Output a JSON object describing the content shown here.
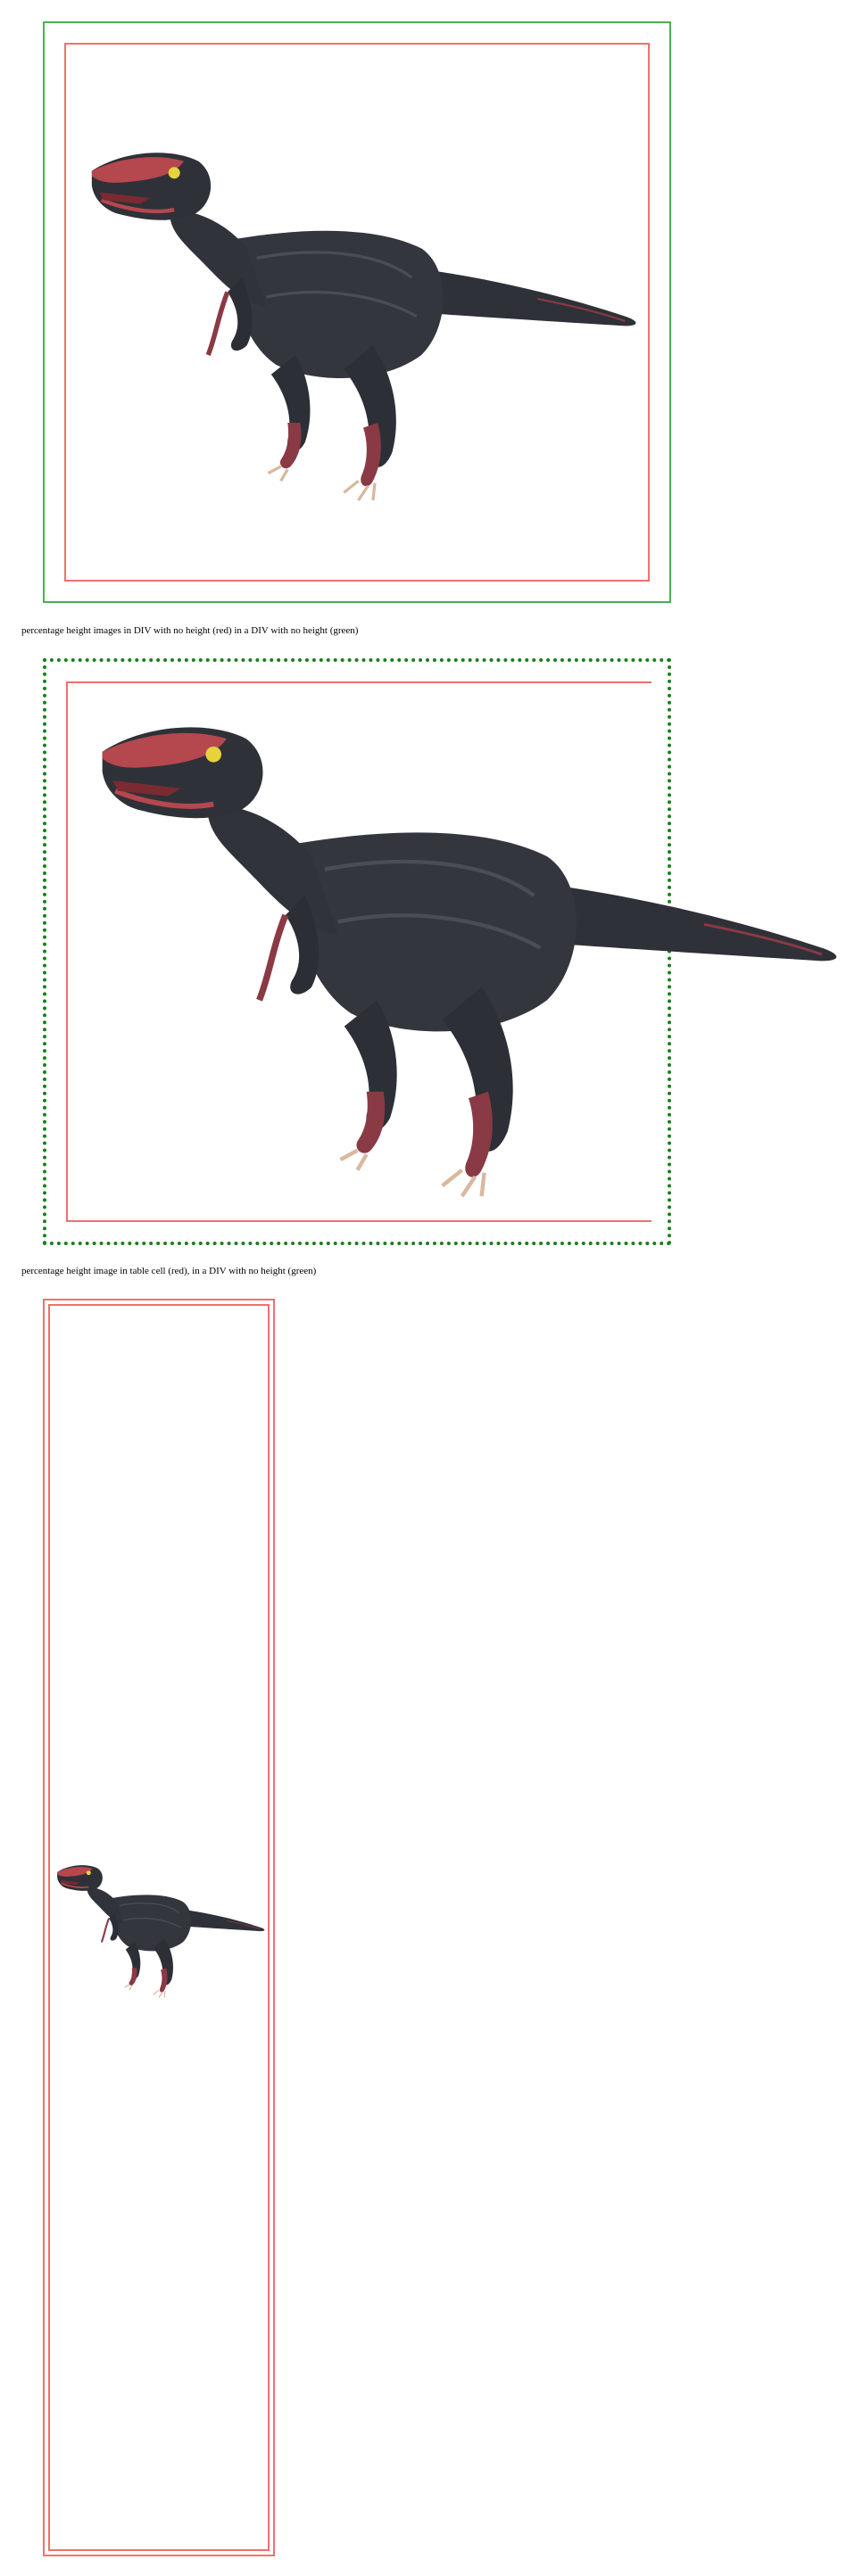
{
  "captions": {
    "first": "percentage height images in DIV with no height (red) in a DIV with no height (green)",
    "second": "percentage height image in table cell (red), in a DIV with no height (green)"
  },
  "colors": {
    "green_outer": "#4caf50",
    "green_dotted": "#1b7f1b",
    "red_inner": "#f07070",
    "dino_body": "#2f3138",
    "dino_head": "#b5474f",
    "dino_eye": "#e6d23a"
  },
  "images": {
    "dino": {
      "icon": "dinosaur-image"
    }
  }
}
